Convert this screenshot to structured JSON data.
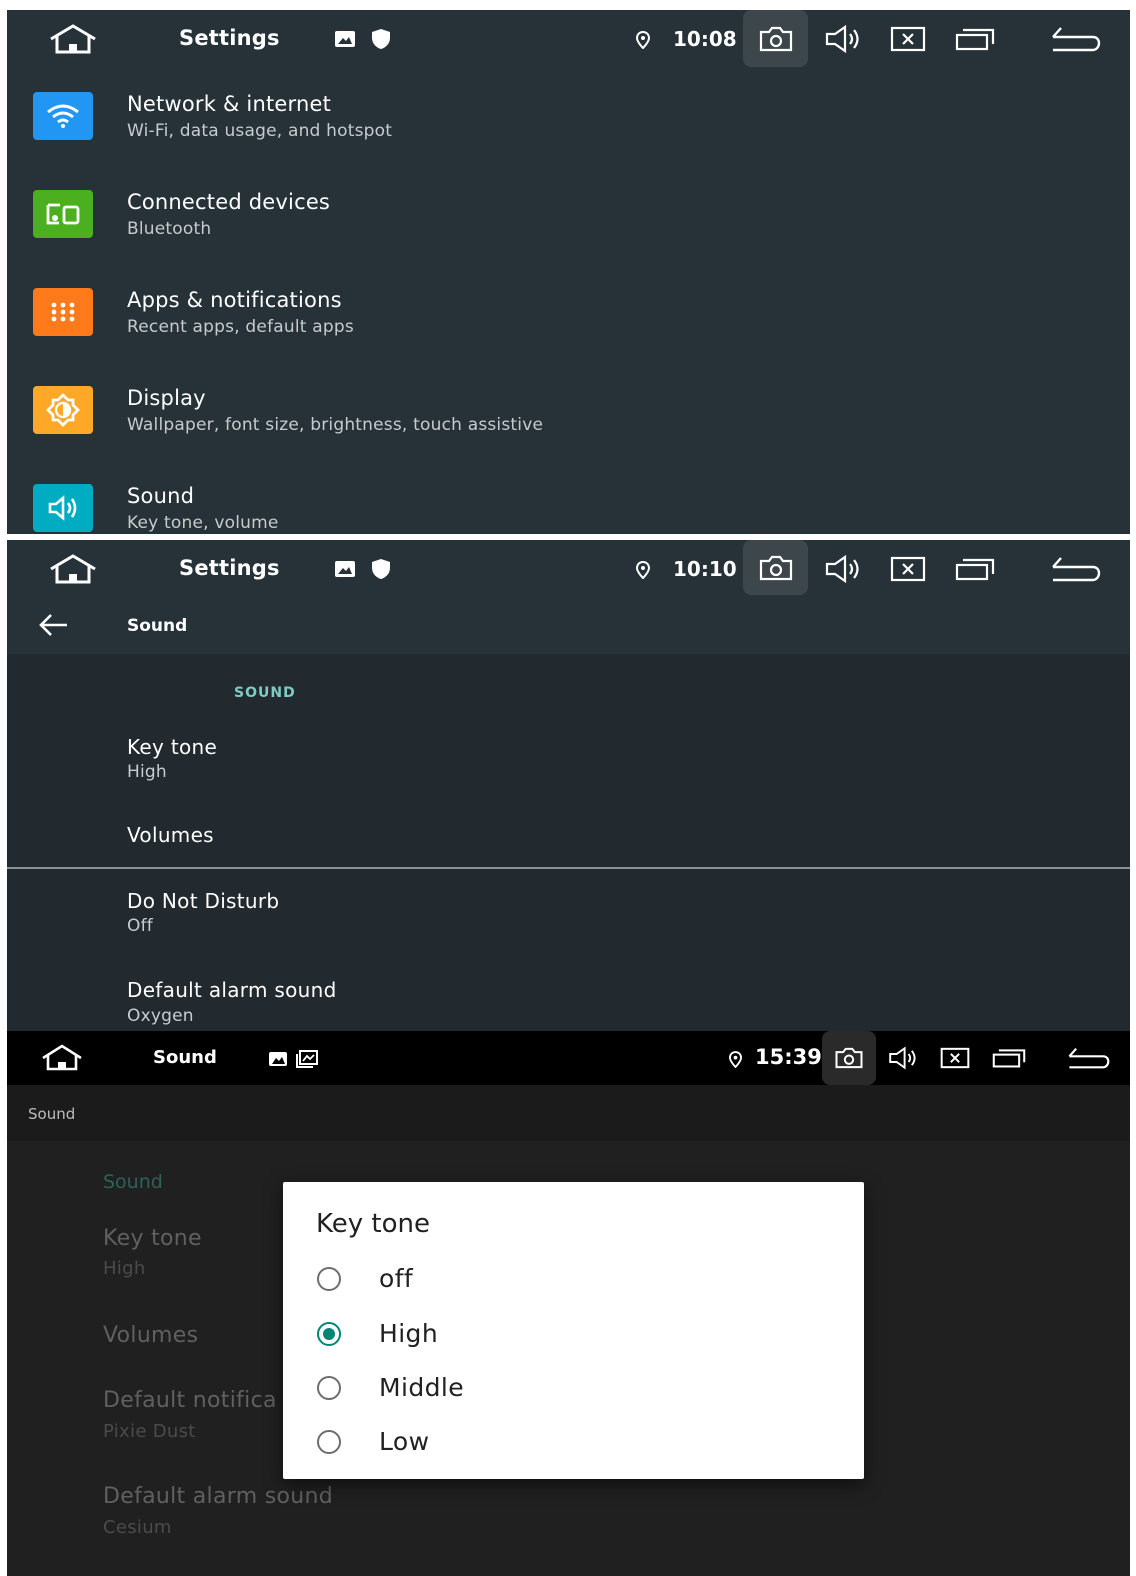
{
  "screen1": {
    "statusbar": {
      "title": "Settings",
      "time": "10:08"
    },
    "items": [
      {
        "title": "Network & internet",
        "subtitle": "Wi-Fi, data usage, and hotspot",
        "icon": "wifi-icon",
        "color": "#2196f3"
      },
      {
        "title": "Connected devices",
        "subtitle": "Bluetooth",
        "icon": "devices-icon",
        "color": "#4caf1f"
      },
      {
        "title": "Apps & notifications",
        "subtitle": "Recent apps, default apps",
        "icon": "apps-grid-icon",
        "color": "#ff7a1a"
      },
      {
        "title": "Display",
        "subtitle": "Wallpaper, font size, brightness, touch assistive",
        "icon": "brightness-icon",
        "color": "#ffa726"
      },
      {
        "title": "Sound",
        "subtitle": "Key tone, volume",
        "icon": "volume-icon",
        "color": "#00acc1"
      }
    ]
  },
  "screen2": {
    "statusbar": {
      "title": "Settings",
      "time": "10:10"
    },
    "page_title": "Sound",
    "section_header": "SOUND",
    "items": [
      {
        "title": "Key tone",
        "subtitle": "High"
      },
      {
        "title": "Volumes",
        "subtitle": ""
      },
      {
        "title": "Do Not Disturb",
        "subtitle": "Off"
      },
      {
        "title": "Default alarm sound",
        "subtitle": "Oxygen"
      }
    ]
  },
  "screen3": {
    "statusbar": {
      "title": "Sound",
      "time": "15:39"
    },
    "page_title": "Sound",
    "section_header": "Sound",
    "background_items": [
      {
        "title": "Key tone",
        "subtitle": "High"
      },
      {
        "title": "Volumes",
        "subtitle": ""
      },
      {
        "title": "Default notifica",
        "subtitle": "Pixie Dust"
      },
      {
        "title": "Default alarm sound",
        "subtitle": "Cesium"
      }
    ],
    "dialog": {
      "title": "Key tone",
      "selected": "High",
      "options": [
        "off",
        "High",
        "Middle",
        "Low"
      ]
    }
  },
  "colors": {
    "panel_bg": "#263238",
    "accent": "#008577",
    "section_accent": "#80cbc4"
  }
}
